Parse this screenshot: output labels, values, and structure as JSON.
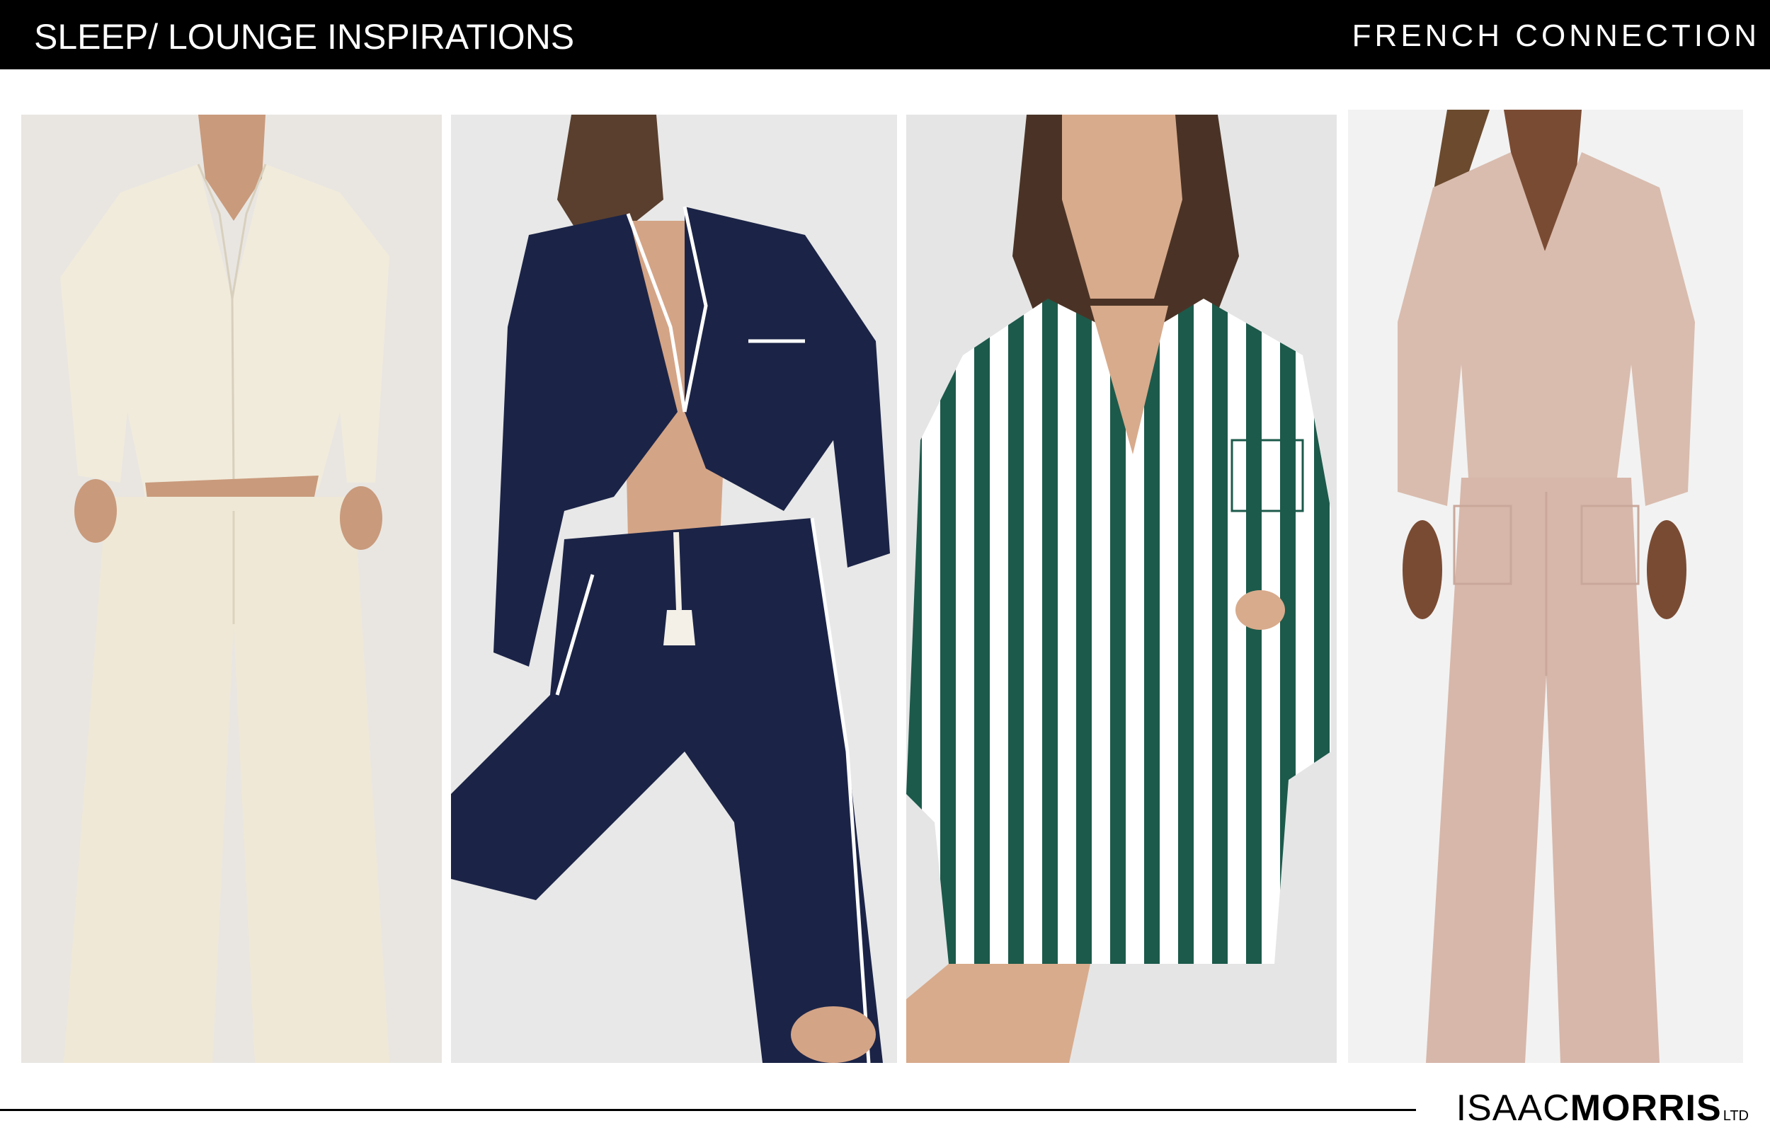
{
  "header": {
    "title": "SLEEP/ LOUNGE INSPIRATIONS",
    "brand": "FRENCH CONNECTION"
  },
  "photos": [
    {
      "subject": "cream satin pajama shirt and wide-leg trousers",
      "colors": {
        "background": "#e9e6e2",
        "garment": "#f1ebdb",
        "skin": "#c99a7c"
      }
    },
    {
      "subject": "navy pajama set with white piping and drawstring",
      "colors": {
        "background": "#e8e8e8",
        "garment": "#1b2447",
        "piping": "#ffffff",
        "skin": "#d4a486"
      }
    },
    {
      "subject": "green and white striped oversized shirt with shorts",
      "colors": {
        "background": "#e5e5e5",
        "stripe_green": "#1c5a4b",
        "stripe_white": "#ffffff",
        "skin": "#d8ab8c"
      }
    },
    {
      "subject": "blush knit v-neck sweater and wide-leg pants",
      "colors": {
        "background": "#f2f2f2",
        "garment": "#d9bcae",
        "skin": "#7a4b33"
      }
    }
  ],
  "footer": {
    "logo_thin": "ISAAC",
    "logo_bold": "MORRIS",
    "logo_suffix": "LTD"
  }
}
